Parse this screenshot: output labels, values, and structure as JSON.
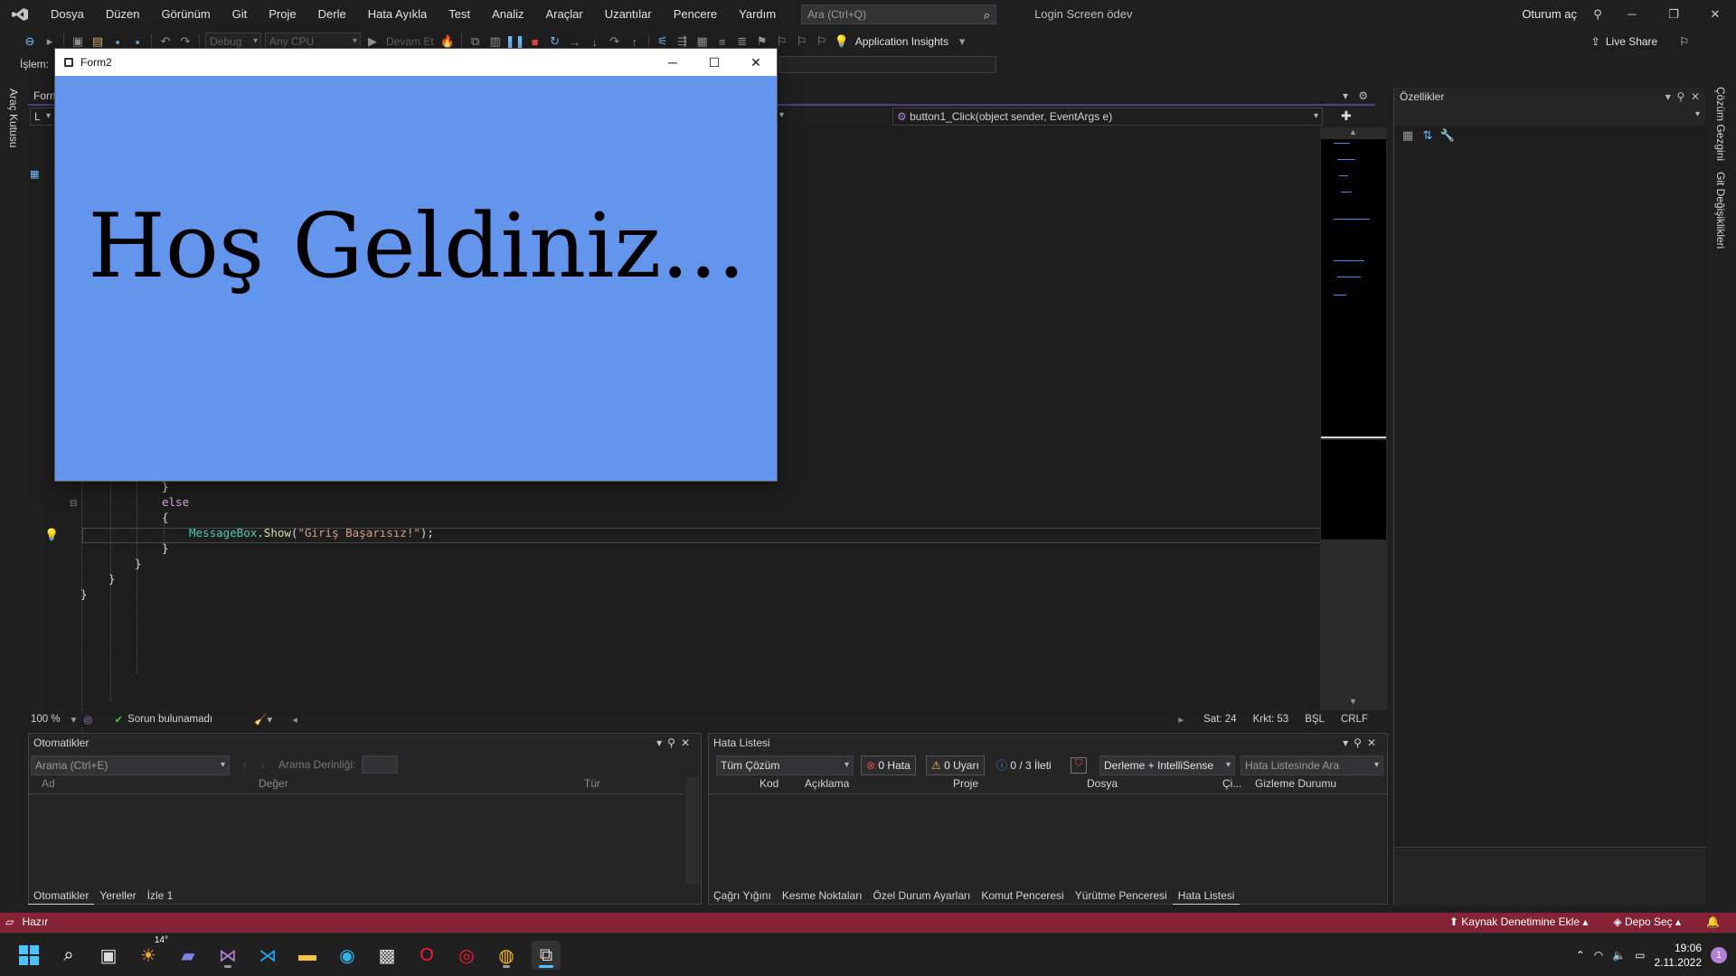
{
  "menubar": {
    "items": [
      "Dosya",
      "Düzen",
      "Görünüm",
      "Git",
      "Proje",
      "Derle",
      "Hata Ayıkla",
      "Test",
      "Analiz",
      "Araçlar",
      "Uzantılar",
      "Pencere",
      "Yardım"
    ],
    "search_placeholder": "Ara (Ctrl+Q)",
    "solution_name": "Login Screen ödev",
    "signin": "Oturum aç"
  },
  "toolbar": {
    "config": "Debug",
    "platform": "Any CPU",
    "continue": "Devam Et",
    "app_insights": "Application Insights",
    "live_share": "Live Share"
  },
  "toolbar2": {
    "process_label": "İşlem:"
  },
  "left_strip": {
    "toolbox": "Araç Kutusu"
  },
  "right_strip": {
    "solution_explorer": "Çözüm Gezgini",
    "git_changes": "Git Değişiklikleri"
  },
  "editor": {
    "doc_tab": "Form",
    "nav_left": "L",
    "nav_method": "button1_Click(object sender, EventArgs e)",
    "code": {
      "close1": "}",
      "else_kw": "else",
      "open1": "{",
      "msg_type": "MessageBox",
      "msg_method": "Show",
      "msg_str": "\"Giriş Başarısız!\"",
      "msg_end": ");",
      "close2": "}",
      "close3": "}",
      "close4": "}",
      "close5": "}"
    },
    "status": {
      "zoom": "100 %",
      "issues": "Sorun bulunamadı",
      "line": "Sat: 24",
      "char": "Krkt: 53",
      "mode": "BŞL",
      "eol": "CRLF"
    }
  },
  "properties": {
    "title": "Özellikler"
  },
  "autos_panel": {
    "title": "Otomatikler",
    "search_placeholder": "Arama (Ctrl+E)",
    "depth_label": "Arama Derinliği:",
    "col_name": "Ad",
    "col_value": "Değer",
    "col_type": "Tür",
    "tabs": [
      "Otomatikler",
      "Yereller",
      "İzle 1"
    ]
  },
  "errors_panel": {
    "title": "Hata Listesi",
    "scope": "Tüm Çözüm",
    "errors": "0 Hata",
    "warnings": "0 Uyarı",
    "messages": "0 / 3 İleti",
    "source": "Derleme + IntelliSense",
    "search_placeholder": "Hata Listesinde Ara",
    "col_code": "Kod",
    "col_desc": "Açıklama",
    "col_project": "Proje",
    "col_file": "Dosya",
    "col_line": "Çi...",
    "col_suppress": "Gizleme Durumu",
    "tabs": [
      "Çağrı Yığını",
      "Kesme Noktaları",
      "Özel Durum Ayarları",
      "Komut Penceresi",
      "Yürütme Penceresi",
      "Hata Listesi"
    ]
  },
  "statusbar": {
    "ready": "Hazır",
    "source_control": "Kaynak Denetimine Ekle",
    "repo": "Depo Seç"
  },
  "taskbar": {
    "weather": "14°",
    "time": "19:06",
    "date": "2.11.2022",
    "notif_count": "1"
  },
  "form2": {
    "title": "Form2",
    "welcome": "Hoş Geldiniz...",
    "bg_color": "#6495ed"
  }
}
